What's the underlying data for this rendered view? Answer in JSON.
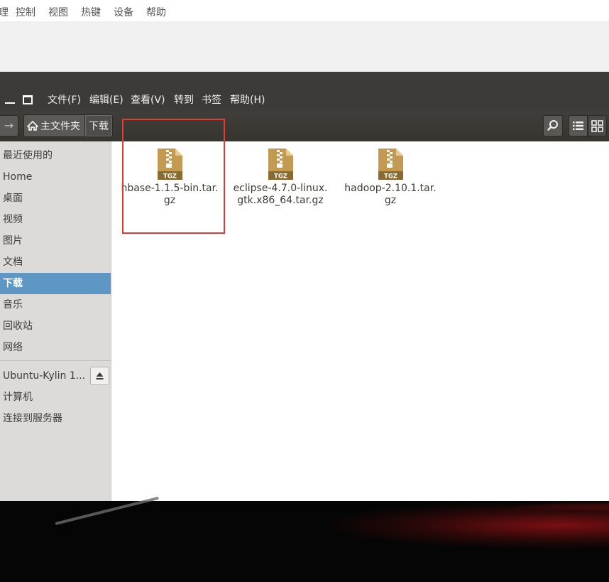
{
  "host_menu": [
    "理",
    "控制",
    "视图",
    "热键",
    "设备",
    "帮助"
  ],
  "window_menu": [
    "文件(F)",
    "编辑(E)",
    "查看(V)",
    "转到",
    "书签",
    "帮助(H)"
  ],
  "breadcrumb": {
    "home": "主文件夹",
    "current": "下载"
  },
  "sidebar": {
    "places": [
      "最近使用的",
      "Home",
      "桌面",
      "视频",
      "图片",
      "文档",
      "下载",
      "音乐",
      "回收站",
      "网络"
    ],
    "active_index": 6,
    "devices": [
      "Ubuntu-Kylin 1...",
      "计算机",
      "连接到服务器"
    ]
  },
  "files": [
    {
      "name_line1": "hbase-1.1.5-bin.tar.",
      "name_line2": "gz",
      "badge": "TGZ"
    },
    {
      "name_line1": "eclipse-4.7.0-linux.",
      "name_line2": "gtk.x86_64.tar.gz",
      "badge": "TGZ"
    },
    {
      "name_line1": "hadoop-2.10.1.tar.",
      "name_line2": "gz",
      "badge": "TGZ"
    }
  ],
  "colors": {
    "accent": "#5f97c4",
    "highlight": "#e53935",
    "panel": "#3c3b37"
  },
  "icons": [
    "forward-arrow-icon",
    "home-icon",
    "search-icon",
    "list-view-icon",
    "grid-view-icon",
    "eject-icon",
    "archive-icon"
  ]
}
